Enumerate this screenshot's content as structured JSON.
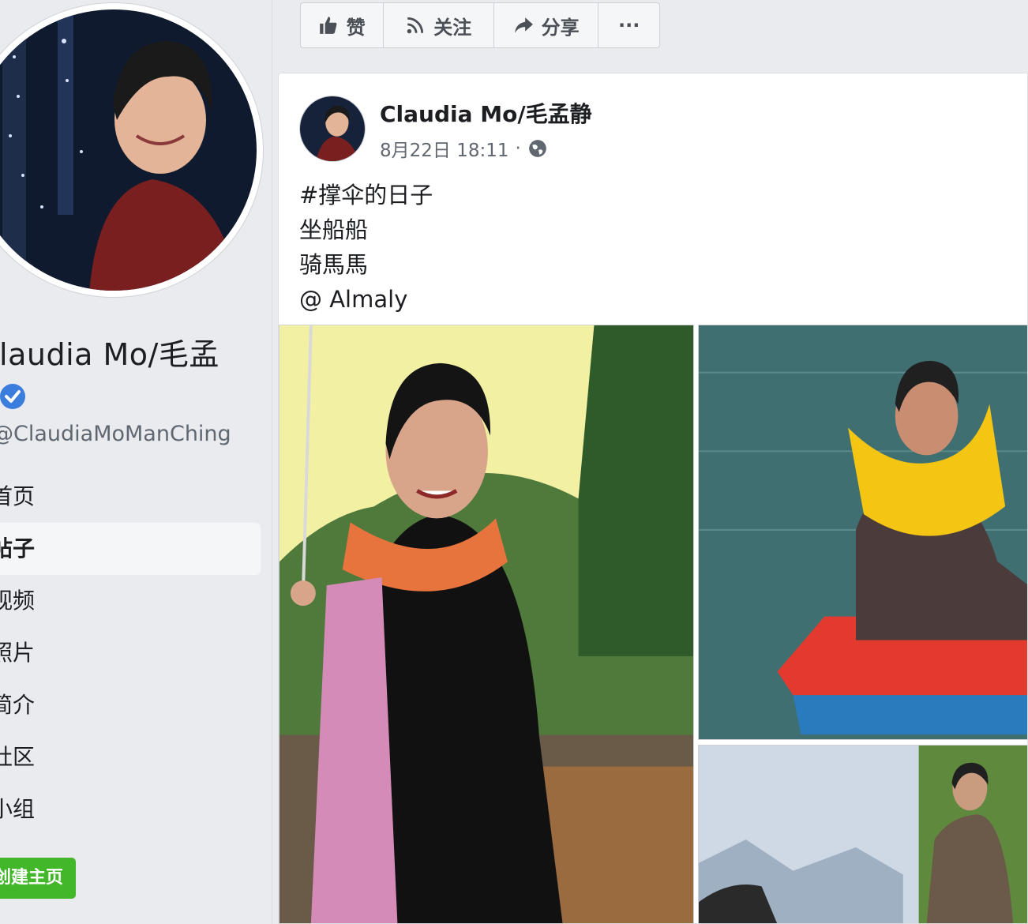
{
  "sidebar": {
    "page_name": "Claudia Mo/毛孟",
    "handle": "@ClaudiaMoManChing",
    "nav_items": [
      {
        "label": "首页",
        "active": false
      },
      {
        "label": "帖子",
        "active": true
      },
      {
        "label": "视频",
        "active": false
      },
      {
        "label": "照片",
        "active": false
      },
      {
        "label": "简介",
        "active": false
      },
      {
        "label": "社区",
        "active": false
      },
      {
        "label": "小组",
        "active": false
      }
    ],
    "cta_label": "创建主页"
  },
  "action_bar": {
    "like_label": "赞",
    "follow_label": "关注",
    "share_label": "分享",
    "more_label": "···"
  },
  "post": {
    "author": "Claudia Mo/毛孟静",
    "date": "8月22日 18:11",
    "separator": "·",
    "text_lines": [
      "#撑伞的日子",
      "坐船船",
      "骑馬馬",
      "@ Almaly"
    ]
  },
  "icons": {
    "verified": "verified-badge-icon",
    "like": "thumbs-up-icon",
    "follow": "rss-follow-icon",
    "share": "share-arrow-icon",
    "privacy": "globe-icon"
  },
  "colors": {
    "brand_blue": "#1877f2",
    "verified_blue": "#3b7ddd",
    "cta_green": "#42b72a",
    "umbrella_yellow": "#f2f0a2",
    "scarf_orange": "#e8743d",
    "life_jacket_yellow": "#f4c613",
    "boat_red": "#e23a2f",
    "lake_teal": "#3f6f70"
  }
}
